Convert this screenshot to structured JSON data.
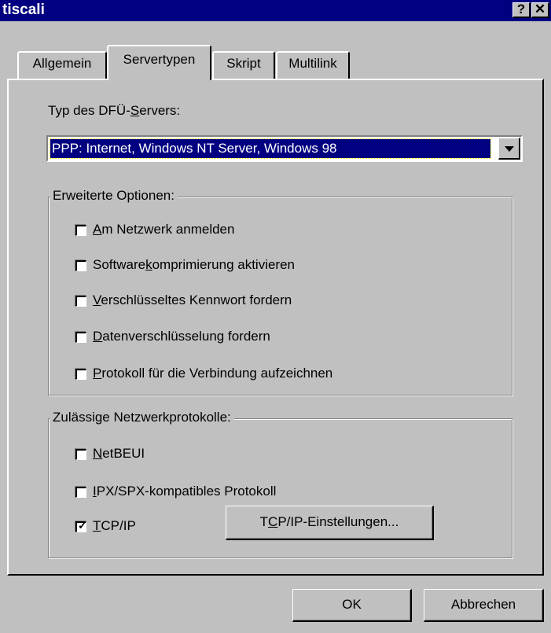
{
  "window": {
    "title": "tiscali",
    "help_glyph": "?",
    "close_glyph": "✕"
  },
  "tabs": [
    {
      "label": "Allgemein"
    },
    {
      "label": "Servertypen"
    },
    {
      "label": "Skript"
    },
    {
      "label": "Multilink"
    }
  ],
  "server_type": {
    "label_before": "Typ des DFÜ-",
    "label_key": "S",
    "label_after": "ervers:",
    "selected_value": "PPP: Internet, Windows NT Server, Windows 98"
  },
  "advanced_options": {
    "legend": "Erweiterte Optionen:",
    "items": [
      {
        "pre": "",
        "key": "A",
        "post": "m Netzwerk anmelden",
        "checked": false
      },
      {
        "pre": "Software",
        "key": "k",
        "post": "omprimierung aktivieren",
        "checked": false
      },
      {
        "pre": "",
        "key": "V",
        "post": "erschlüsseltes Kennwort fordern",
        "checked": false
      },
      {
        "pre": "",
        "key": "D",
        "post": "atenverschlüsselung fordern",
        "checked": false
      },
      {
        "pre": "",
        "key": "P",
        "post": "rotokoll für die Verbindung aufzeichnen",
        "checked": false
      }
    ]
  },
  "protocols": {
    "legend": "Zulässige Netzwerkprotokolle:",
    "items": [
      {
        "pre": "",
        "key": "N",
        "post": "etBEUI",
        "checked": false
      },
      {
        "pre": "",
        "key": "I",
        "post": "PX/SPX-kompatibles Protokoll",
        "checked": false
      },
      {
        "pre": "",
        "key": "T",
        "post": "CP/IP",
        "checked": true
      }
    ],
    "settings_button": {
      "pre": "T",
      "key": "C",
      "post": "P/IP-Einstellungen..."
    }
  },
  "footer": {
    "ok_label": "OK",
    "cancel_label": "Abbrechen",
    "check_glyph": "✓"
  }
}
